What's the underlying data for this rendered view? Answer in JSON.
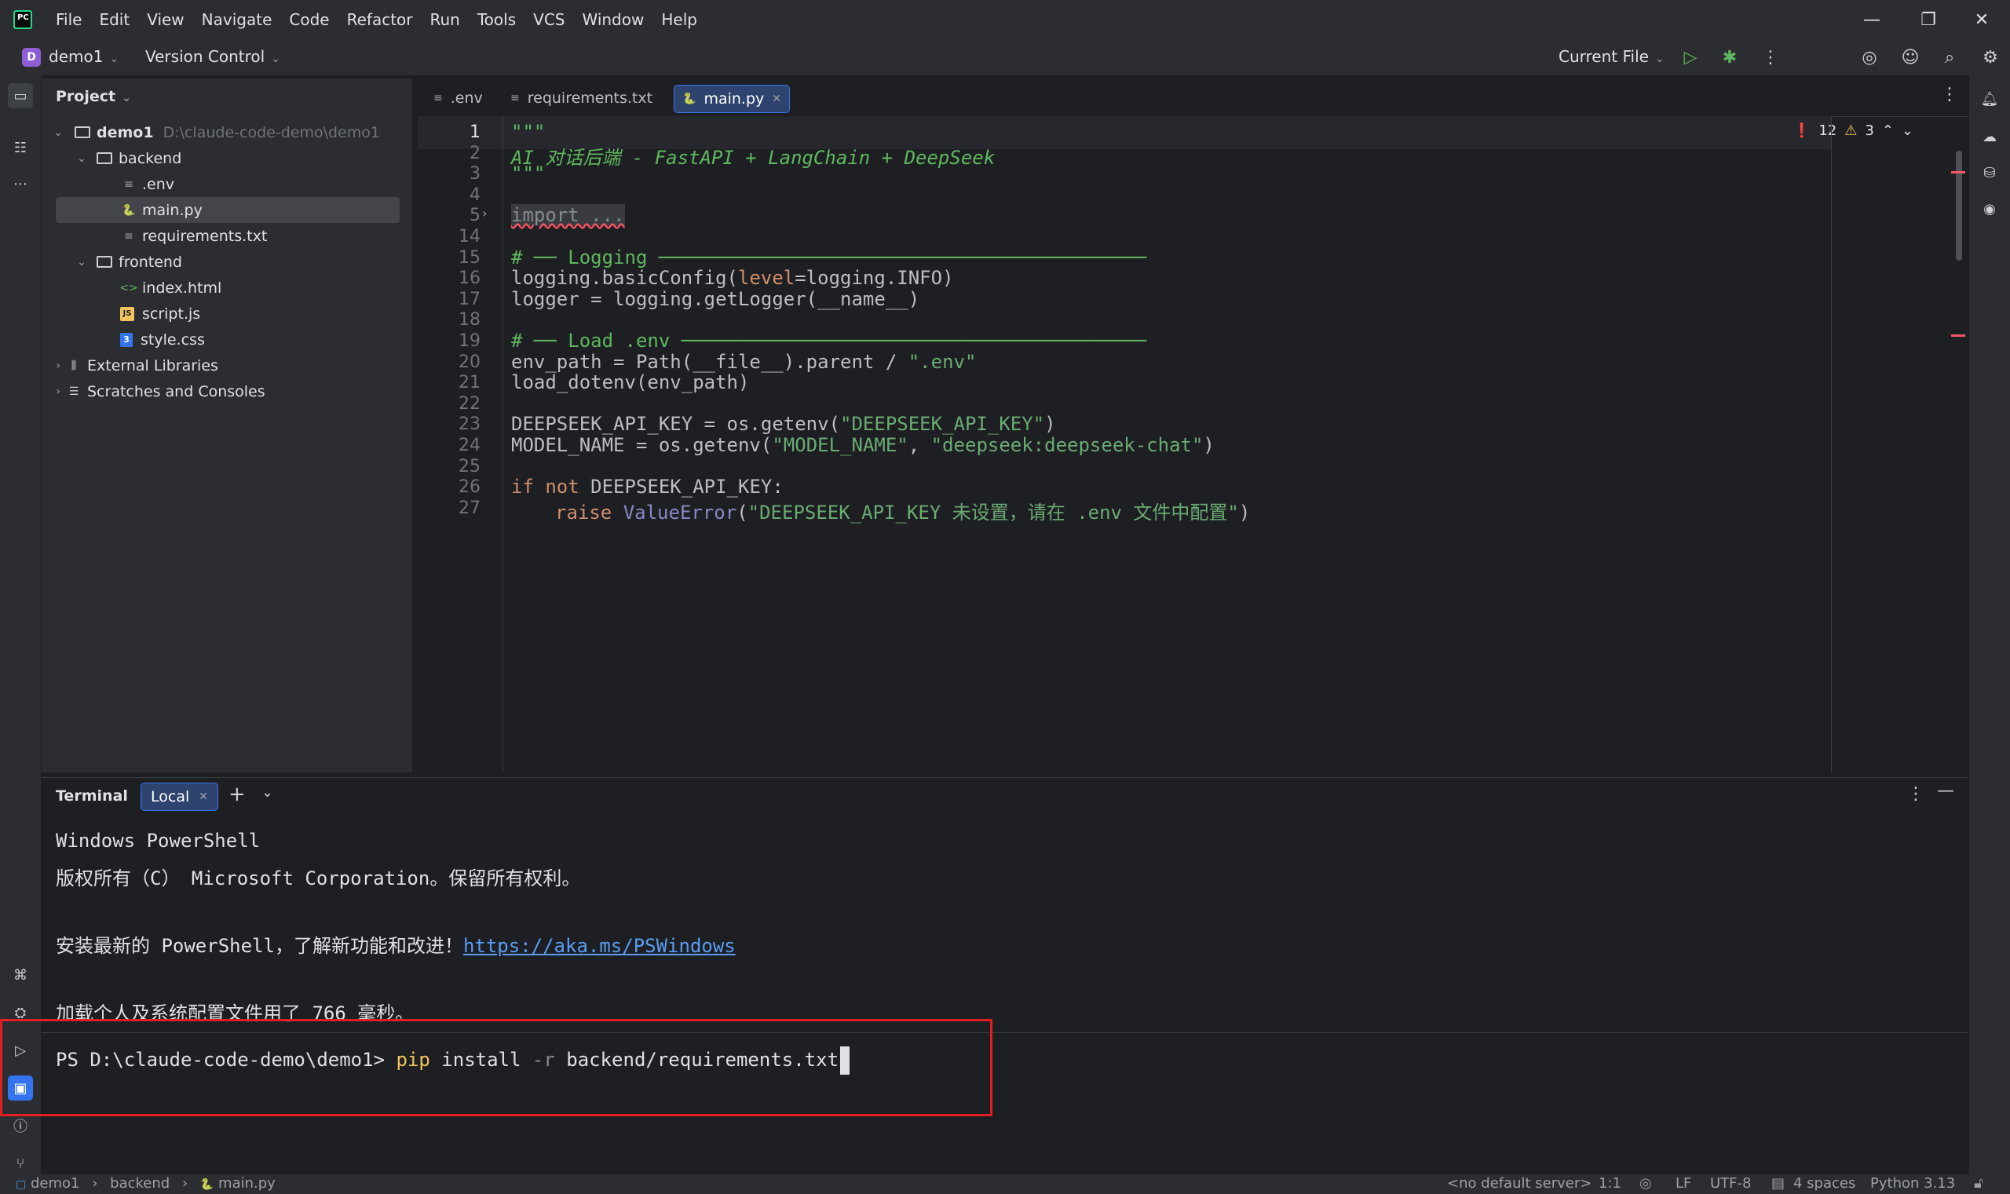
{
  "menu": [
    "File",
    "Edit",
    "View",
    "Navigate",
    "Code",
    "Refactor",
    "Run",
    "Tools",
    "VCS",
    "Window",
    "Help"
  ],
  "app_logo_text": "PC",
  "toolbar": {
    "project_badge": "D",
    "project_name": "demo1",
    "vcs": "Version Control",
    "run_config": "Current File"
  },
  "project_panel": {
    "title": "Project",
    "root_name": "demo1",
    "root_path": "D:\\claude-code-demo\\demo1",
    "items": [
      {
        "label": "backend"
      },
      {
        "label": ".env"
      },
      {
        "label": "main.py"
      },
      {
        "label": "requirements.txt"
      },
      {
        "label": "frontend"
      },
      {
        "label": "index.html"
      },
      {
        "label": "script.js"
      },
      {
        "label": "style.css"
      },
      {
        "label": "External Libraries"
      },
      {
        "label": "Scratches and Consoles"
      }
    ]
  },
  "tabs": [
    {
      "label": ".env"
    },
    {
      "label": "requirements.txt"
    },
    {
      "label": "main.py"
    }
  ],
  "inspections": {
    "errors": "12",
    "warnings": "3"
  },
  "editor": {
    "line_numbers": [
      "1",
      "2",
      "3",
      "4",
      "5",
      "14",
      "15",
      "16",
      "17",
      "18",
      "19",
      "20",
      "21",
      "22",
      "23",
      "24",
      "25",
      "26",
      "27"
    ],
    "lines": {
      "l1": "\"\"\"",
      "l2": "AI 对话后端 - FastAPI + LangChain + DeepSeek",
      "l3": "\"\"\"",
      "l5": "import ...",
      "l15": "# ── Logging ───────────────────────────────────────────",
      "l16a": "logging.basicConfig(",
      "l16b": "level",
      "l16c": "=logging.INFO)",
      "l17": "logger = logging.getLogger(__name__)",
      "l19": "# ── Load .env ─────────────────────────────────────────",
      "l20a": "env_path = Path(__file__).parent / ",
      "l20b": "\".env\"",
      "l21": "load_dotenv(env_path)",
      "l23a": "DEEPSEEK_API_KEY = os.getenv(",
      "l23b": "\"DEEPSEEK_API_KEY\"",
      "l23c": ")",
      "l24a": "MODEL_NAME = os.getenv(",
      "l24b": "\"MODEL_NAME\"",
      "l24c": ", ",
      "l24d": "\"deepseek:deepseek-chat\"",
      "l24e": ")",
      "l26a": "if not",
      "l26b": " DEEPSEEK_API_KEY:",
      "l27a": "raise",
      "l27b": "ValueError",
      "l27c": "(",
      "l27d": "\"DEEPSEEK_API_KEY 未设置，请在 .env 文件中配置\"",
      "l27e": ")"
    }
  },
  "terminal": {
    "title": "Terminal",
    "tab": "Local",
    "line1": "Windows PowerShell",
    "line2": "版权所有（C） Microsoft Corporation。保留所有权利。",
    "line3_text": "安装最新的 PowerShell，了解新功能和改进！",
    "line3_link": "https://aka.ms/PSWindows",
    "line4": "加载个人及系统配置文件用了 766 毫秒。",
    "prompt": "PS D:\\claude-code-demo\\demo1> ",
    "cmd": "pip",
    "cmd_arg1": " install ",
    "cmd_flag": "-r",
    "cmd_arg2": " backend/requirements.txt"
  },
  "status": {
    "crumb1": "demo1",
    "crumb2": "backend",
    "crumb3": "main.py",
    "server": "<no default server>",
    "position": "1:1",
    "line_sep": "LF",
    "encoding": "UTF-8",
    "indent": "4 spaces",
    "interpreter": "Python 3.13"
  },
  "colors": {
    "accent": "#3574f0",
    "error": "#f75464",
    "highlight_box": "#e02020"
  }
}
